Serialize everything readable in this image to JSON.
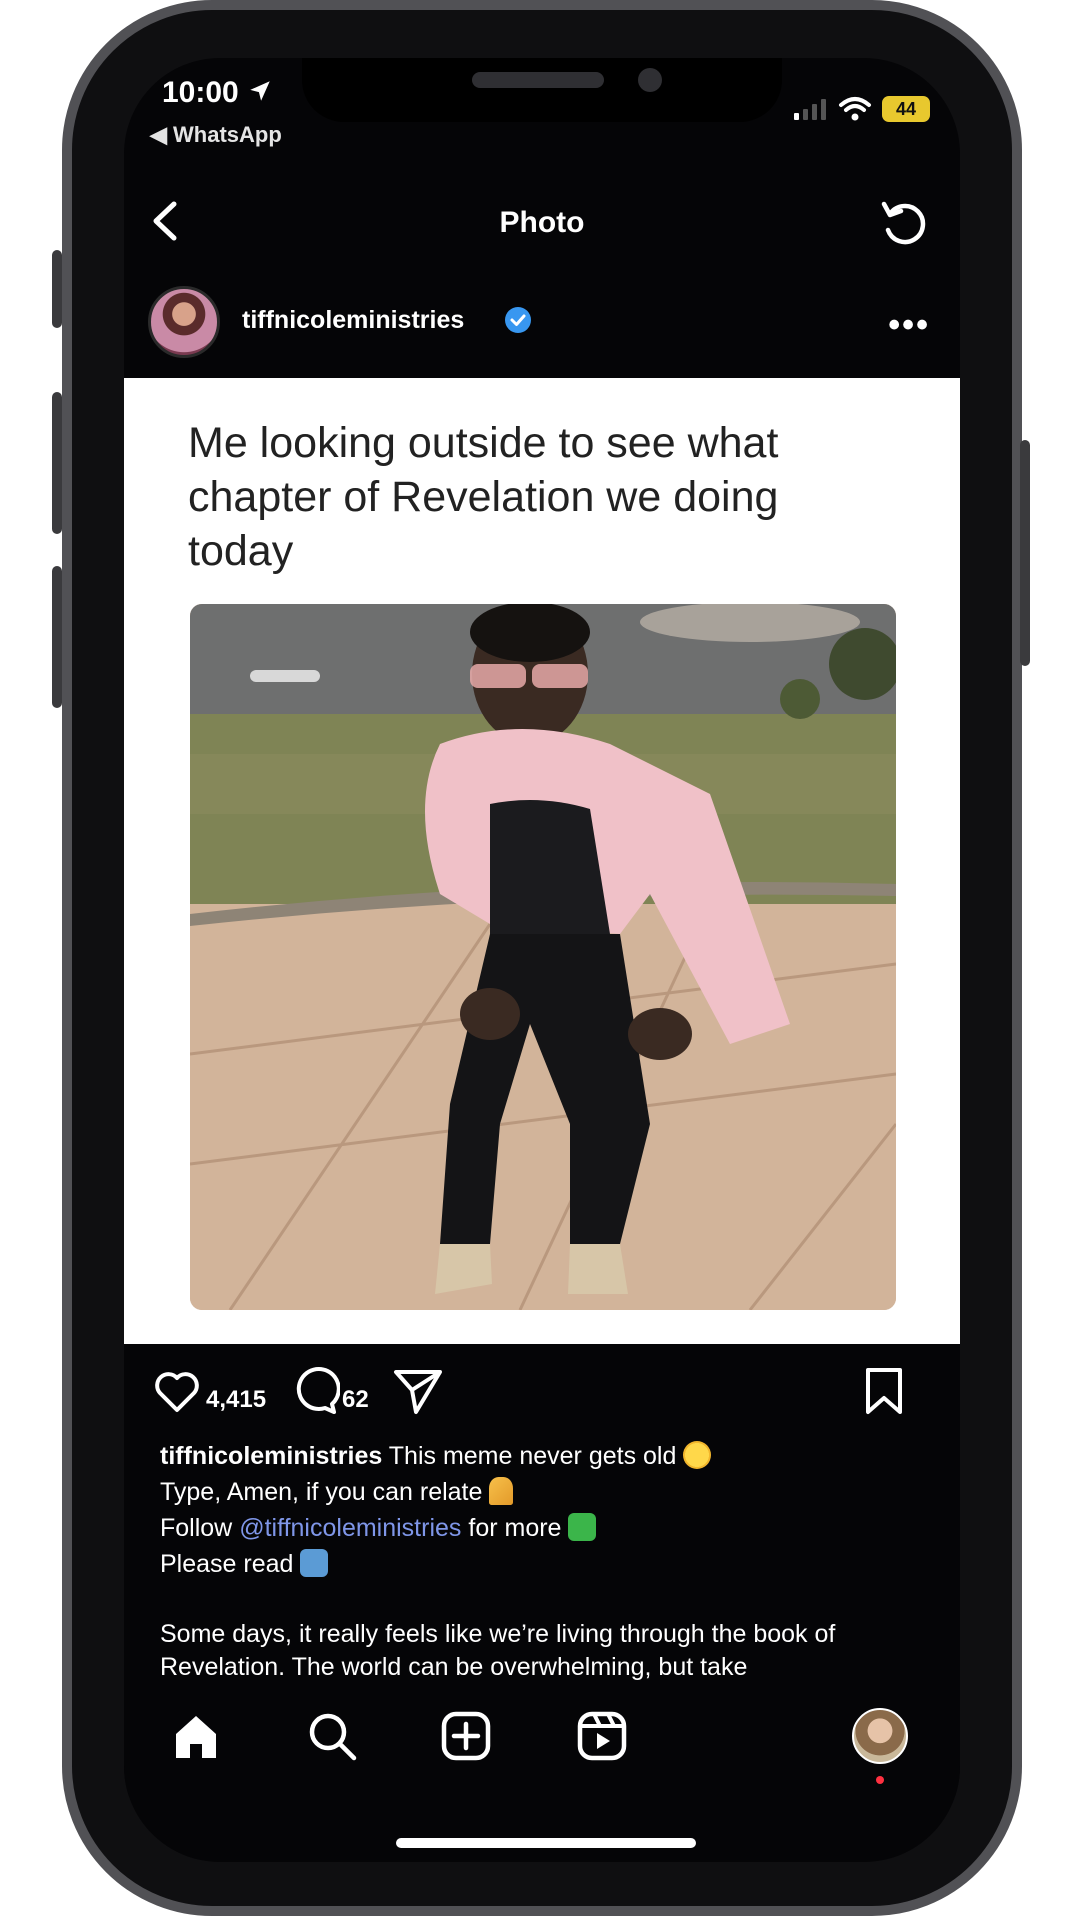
{
  "status_bar": {
    "time": "10:00",
    "back_app": "◀ WhatsApp",
    "battery": "44"
  },
  "nav": {
    "title": "Photo"
  },
  "post": {
    "username": "tiffnicoleministries",
    "more": "•••",
    "meme_text": "Me looking outside to see what chapter of Revelation we doing today",
    "likes": "4,415",
    "comments": "62"
  },
  "caption": {
    "username": "tiffnicoleministries",
    "line1": "This meme never gets old",
    "line2": "Type, Amen, if you can relate",
    "line3_prefix": "Follow",
    "line3_mention": "@tiffnicoleministries",
    "line3_suffix": "for more",
    "line4": "Please read",
    "body": "Some days, it really feels like we’re living through the book of Revelation. The world can be overwhelming, but take"
  },
  "colors": {
    "background": "#050507",
    "text": "#ffffff",
    "mention": "#7f96e8",
    "verified": "#3897f0",
    "notification": "#ff3040",
    "battery": "#e8c82e"
  },
  "icons": [
    "location-arrow-icon",
    "cellular-signal-icon",
    "wifi-icon",
    "battery-icon",
    "back-chevron-icon",
    "refresh-icon",
    "verified-badge-icon",
    "heart-icon",
    "comment-icon",
    "share-icon",
    "bookmark-icon",
    "grinning-sweat-emoji",
    "praying-hands-emoji",
    "check-mark-emoji",
    "down-arrow-emoji",
    "home-icon",
    "search-icon",
    "create-post-icon",
    "reels-icon"
  ]
}
